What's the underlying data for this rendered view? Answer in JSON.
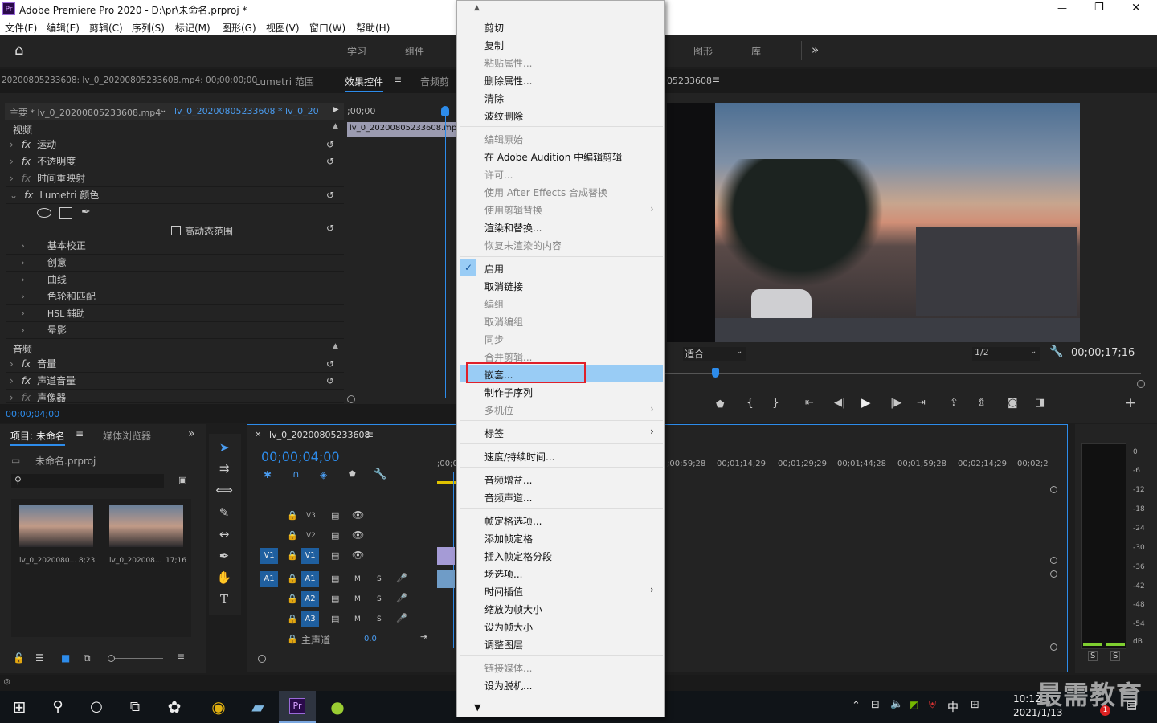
{
  "app": {
    "title": "Adobe Premiere Pro 2020 - D:\\pr\\未命名.prproj *",
    "logo": "Pr"
  },
  "window_controls": [
    "—",
    "❐",
    "✕"
  ],
  "menu": [
    "文件(F)",
    "编辑(E)",
    "剪辑(C)",
    "序列(S)",
    "标记(M)",
    "图形(G)",
    "视图(V)",
    "窗口(W)",
    "帮助(H)"
  ],
  "workspaces": {
    "left": [
      "学习",
      "组件"
    ],
    "right": [
      "图形",
      "库"
    ],
    "more": "»"
  },
  "source_panel": {
    "clip_path": "20200805233608: lv_0_20200805233608.mp4: 00;00;00;00",
    "tabs": [
      "Lumetri 范围",
      "效果控件",
      "音频剪"
    ],
    "active_tab": "效果控件"
  },
  "effect_controls": {
    "master": "主要 * lv_0_20200805233608.mp4",
    "sequence": "lv_0_20200805233608 * lv_0_2020...",
    "timecode_ruler": ";00;00",
    "clip_label": "lv_0_20200805233608.mp4",
    "video_header": "视频",
    "video_effects": [
      "运动",
      "不透明度",
      "时间重映射",
      "Lumetri 颜色"
    ],
    "hdr_label": "高动态范围",
    "lumetri_sections": [
      "基本校正",
      "创意",
      "曲线",
      "色轮和匹配",
      "HSL 辅助",
      "晕影"
    ],
    "audio_header": "音频",
    "audio_effects": [
      "音量",
      "声道音量",
      "声像器"
    ],
    "timecode": "00;00;04;00"
  },
  "program": {
    "title_fragment": "05233608",
    "fit": "适合",
    "resolution": "1/2",
    "timecode": "00;00;17;16"
  },
  "project": {
    "tabs": [
      "项目: 未命名",
      "媒体浏览器"
    ],
    "file": "未命名.prproj",
    "search_placeholder": "",
    "items": [
      {
        "name": "lv_0_2020080...",
        "dur": "8;23"
      },
      {
        "name": "lv_0_202008...",
        "dur": "17;16"
      }
    ]
  },
  "timeline": {
    "title": "lv_0_20200805233608",
    "timecode": "00;00;04;00",
    "ruler": [
      ";00;0",
      ";00;59;28",
      "00;01;14;29",
      "00;01;29;29",
      "00;01;44;28",
      "00;01;59;28",
      "00;02;14;29",
      "00;02;2"
    ],
    "video_tracks": [
      "V3",
      "V2",
      "V1"
    ],
    "audio_tracks": [
      "A1",
      "A2",
      "A3"
    ],
    "source_v": "V1",
    "source_a": "A1",
    "mix": "主声道",
    "mix_val": "0.0",
    "m": "M",
    "s": "S"
  },
  "meters": {
    "labels": [
      "0",
      "-6",
      "-12",
      "-18",
      "-24",
      "-30",
      "-36",
      "-42",
      "-48",
      "-54",
      "dB"
    ],
    "solo": [
      "S",
      "S"
    ]
  },
  "context_menu": {
    "items": [
      {
        "label": "剪切",
        "dis": false
      },
      {
        "label": "复制",
        "dis": false
      },
      {
        "label": "粘贴属性...",
        "dis": true
      },
      {
        "label": "删除属性...",
        "dis": false
      },
      {
        "label": "清除",
        "dis": false
      },
      {
        "label": "波纹删除",
        "dis": false
      },
      {
        "label": "编辑原始",
        "dis": true
      },
      {
        "label": "在 Adobe Audition 中编辑剪辑",
        "dis": false
      },
      {
        "label": "许可...",
        "dis": true
      },
      {
        "label": "使用 After Effects 合成替换",
        "dis": true
      },
      {
        "label": "使用剪辑替换",
        "dis": true
      },
      {
        "label": "渲染和替换...",
        "dis": false
      },
      {
        "label": "恢复未渲染的内容",
        "dis": true
      },
      {
        "label": "启用",
        "dis": false
      },
      {
        "label": "取消链接",
        "dis": false
      },
      {
        "label": "编组",
        "dis": true
      },
      {
        "label": "取消编组",
        "dis": true
      },
      {
        "label": "同步",
        "dis": true
      },
      {
        "label": "合并剪辑...",
        "dis": true
      },
      {
        "label": "嵌套...",
        "dis": false
      },
      {
        "label": "制作子序列",
        "dis": false
      },
      {
        "label": "多机位",
        "dis": true
      },
      {
        "label": "标签",
        "dis": false
      },
      {
        "label": "速度/持续时间...",
        "dis": false
      },
      {
        "label": "音频增益...",
        "dis": false
      },
      {
        "label": "音频声道...",
        "dis": false
      },
      {
        "label": "帧定格选项...",
        "dis": false
      },
      {
        "label": "添加帧定格",
        "dis": false
      },
      {
        "label": "插入帧定格分段",
        "dis": false
      },
      {
        "label": "场选项...",
        "dis": false
      },
      {
        "label": "时间插值",
        "dis": false
      },
      {
        "label": "缩放为帧大小",
        "dis": false
      },
      {
        "label": "设为帧大小",
        "dis": false
      },
      {
        "label": "调整图层",
        "dis": false
      },
      {
        "label": "链接媒体...",
        "dis": true
      },
      {
        "label": "设为脱机...",
        "dis": false
      }
    ],
    "highlighted": "嵌套..."
  },
  "taskbar": {
    "time": "10:12",
    "date": "2021/1/13",
    "ime": "中",
    "watermark": "最需教育",
    "badge": "1"
  },
  "colors": {
    "accent": "#2d8ceb",
    "highlight": "#99ccf5",
    "red_box": "#e0202a",
    "track": "#1f5f9f"
  }
}
